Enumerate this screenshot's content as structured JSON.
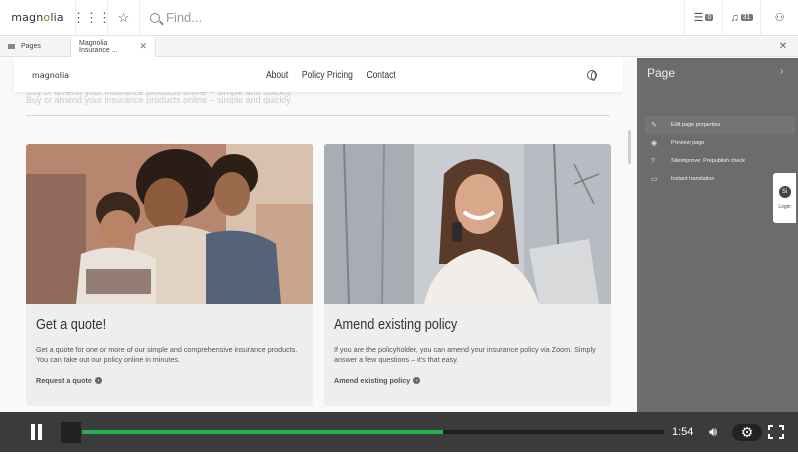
{
  "topbar": {
    "logo_prefix": "magn",
    "logo_o": "o",
    "logo_suffix": "lia",
    "search_placeholder": "Find...",
    "tasks_count": "0",
    "notifications_count": "31"
  },
  "tabs": {
    "pages_label": "Pages",
    "active_label": "Magnolia Insurance ...",
    "close_label": "×"
  },
  "site": {
    "logo": "magnolia",
    "nav": [
      "About",
      "Policy Pricing",
      "Contact"
    ],
    "ghost_line_1": "Buy or amend your insurance products online – simple and quickly.",
    "ghost_line_2": "Buy or amend your insurance products online – simple and quickly."
  },
  "cards": [
    {
      "title": "Get a quote!",
      "body": "Get a quote for one or more of our simple and comprehensive insurance products. You can take out our policy online in minutes.",
      "link": "Request a quote"
    },
    {
      "title": "Amend existing policy",
      "body": "If you are the policyholder, you can amend your insurance policy via Zoom. Simply answer a few questions – it's that easy.",
      "link": "Amend existing policy"
    }
  ],
  "panel": {
    "title": "Page",
    "actions": [
      {
        "icon": "pencil-icon",
        "label": "Edit page properties"
      },
      {
        "icon": "eye-icon",
        "label": "Preview page"
      },
      {
        "icon": "help-icon",
        "label": "Siteimprove: Prepublish check"
      },
      {
        "icon": "translate-icon",
        "label": "Instant translation"
      }
    ],
    "si_label": "Si",
    "login_label": "Login"
  },
  "video": {
    "time": "1:54",
    "progress": 0.62
  },
  "colors": {
    "accent_green": "#22b14c",
    "panel_bg": "#6c6c6c",
    "logo_green": "#599a1f"
  }
}
